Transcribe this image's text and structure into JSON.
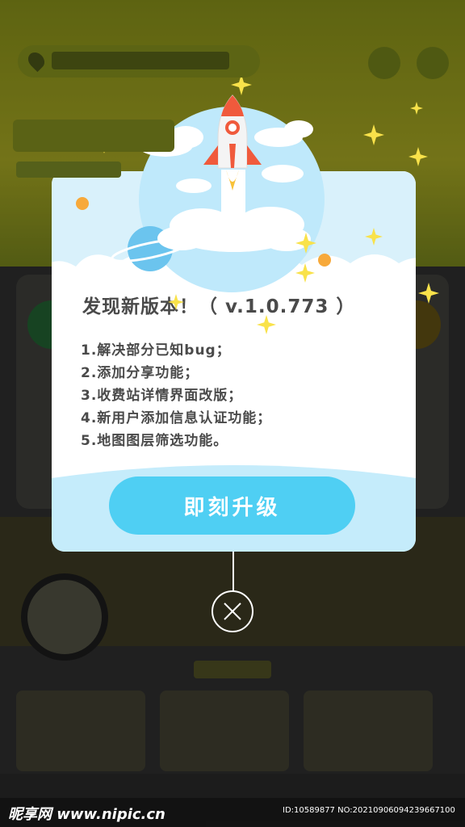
{
  "dialog": {
    "title": "发现新版本！（ v.1.0.773 ）",
    "notes": [
      "1.解决部分已知bug；",
      "2.添加分享功能；",
      "3.收费站详情界面改版；",
      "4.新用户添加信息认证功能；",
      "5.地图图层筛选功能。"
    ],
    "upgrade_label": "即刻升级"
  },
  "icons": {
    "close": "close-icon",
    "rocket": "rocket-icon",
    "sparkle": "sparkle-icon"
  },
  "colors": {
    "accent": "#4fcff3",
    "text": "#4a4a4a",
    "sparkle": "#f9e24a",
    "rocket": "#f05a3c"
  },
  "watermark": {
    "logo": "昵享网 www.nipic.cn",
    "id": "ID:10589877 NO:20210906094239667100"
  }
}
